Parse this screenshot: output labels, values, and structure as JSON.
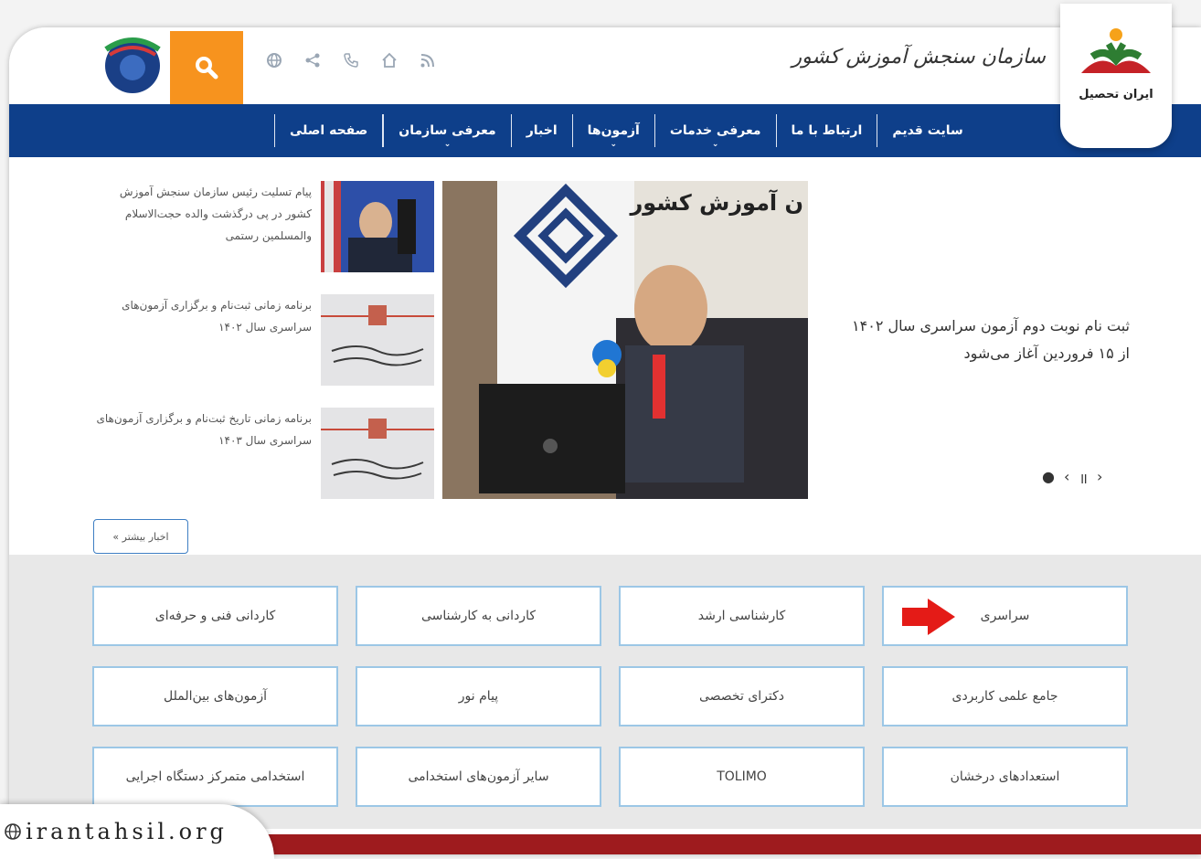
{
  "header": {
    "org_title": "سازمان سنجش آموزش کشور"
  },
  "nav": {
    "items": [
      {
        "label": "صفحه اصلی",
        "has_caret": false
      },
      {
        "label": "معرفی سازمان",
        "has_caret": true
      },
      {
        "label": "اخبار",
        "has_caret": false
      },
      {
        "label": "آزمون‌ها",
        "has_caret": true
      },
      {
        "label": "معرفی خدمات",
        "has_caret": true
      },
      {
        "label": "ارتباط با ما",
        "has_caret": false
      },
      {
        "label": "سایت قدیم",
        "has_caret": false
      }
    ]
  },
  "slider": {
    "headline_line1": "ثبت نام نوبت دوم آزمون سراسری سال ۱۴۰۲",
    "headline_line2": "از ۱۵ فروردین آغاز می‌شود",
    "image_caption": "ن آموزش کشور",
    "controls": {
      "dot": "●",
      "prev": "‹",
      "pause": "॥",
      "next": "›"
    }
  },
  "news": [
    {
      "text": "پیام تسلیت رئیس سازمان سنجش آموزش کشور در پی درگذشت والده حجت‌الاسلام والمسلمین رستمی"
    },
    {
      "text": "برنامه زمانی ثبت‌نام و برگزاری آزمون‌های سراسری سال ۱۴۰۲"
    },
    {
      "text": "برنامه زمانی تاریخ ثبت‌نام و برگزاری آزمون‌های سراسری سال ۱۴۰۳"
    }
  ],
  "more_news_label": "اخبار بیشتر »",
  "tiles": [
    {
      "label": "سراسری"
    },
    {
      "label": "کارشناسی ارشد"
    },
    {
      "label": "کاردانی به کارشناسی"
    },
    {
      "label": "کاردانی فنی و حرفه‌ای"
    },
    {
      "label": "جامع علمی کاربردی"
    },
    {
      "label": "دکترای تخصصی"
    },
    {
      "label": "پیام نور"
    },
    {
      "label": "آزمون‌های بین‌الملل"
    },
    {
      "label": "استعدادهای درخشان"
    },
    {
      "label": "TOLIMO"
    },
    {
      "label": "سایر آزمون‌های استخدامی"
    },
    {
      "label": "استخدامی متمرکز دستگاه اجرایی"
    }
  ],
  "brand": {
    "name": "ایران تحصیل"
  },
  "watermark": {
    "domain": "irantahsil.org"
  },
  "colors": {
    "nav": "#0e3f8a",
    "search": "#f7931e",
    "accent_red": "#9e1b1e",
    "tile_border": "#9cc7e6"
  }
}
